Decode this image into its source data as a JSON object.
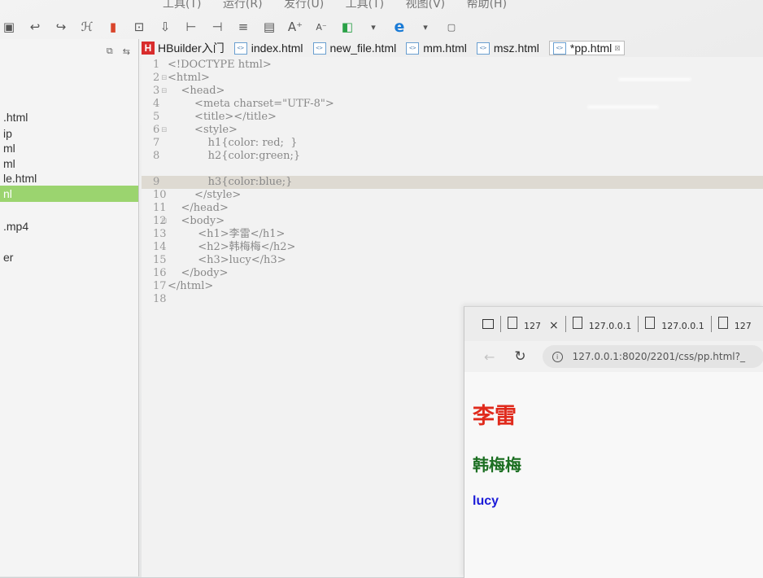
{
  "menubar": [
    "工具(T)",
    "运行(R)",
    "发行(U)",
    "工具(T)",
    "视图(V)",
    "帮助(H)"
  ],
  "toolbar_icons": [
    "save-icon",
    "undo-icon",
    "redo-icon",
    "format-icon",
    "bookmark-icon",
    "new-file-icon",
    "import-icon",
    "indent-icon",
    "outdent-icon",
    "wrap-icon",
    "comment-icon",
    "font-increase-icon",
    "font-decrease-icon",
    "run-icon",
    "browser-icon",
    "settings-icon"
  ],
  "sidebar": {
    "items": [
      ".html",
      "ip",
      "ml",
      "ml",
      "le.html",
      "nl",
      ".mp4",
      "er"
    ]
  },
  "tabs": [
    {
      "label": "HBuilder入门",
      "active": false
    },
    {
      "label": "index.html",
      "active": false
    },
    {
      "label": "new_file.html",
      "active": false
    },
    {
      "label": "mm.html",
      "active": false
    },
    {
      "label": "msz.html",
      "active": false
    },
    {
      "label": "*pp.html",
      "active": true
    }
  ],
  "editor": {
    "lines": [
      {
        "n": "1",
        "code": "<!DOCTYPE html>"
      },
      {
        "n": "2",
        "code": "<html>"
      },
      {
        "n": "3",
        "code": "    <head>"
      },
      {
        "n": "4",
        "code": "        <meta charset=\"UTF-8\">"
      },
      {
        "n": "5",
        "code": "        <title></title>"
      },
      {
        "n": "6",
        "code": "        <style>"
      },
      {
        "n": "7",
        "code": "            h1{color: red;  }"
      },
      {
        "n": "8",
        "code": "            h2{color:green;}"
      },
      {
        "n": "9",
        "code": "            h3{color:blue;}"
      },
      {
        "n": "10",
        "code": "        </style>"
      },
      {
        "n": "11",
        "code": "    </head>"
      },
      {
        "n": "12",
        "code": "    <body>"
      },
      {
        "n": "13",
        "code": "         <h1>李雷</h1>"
      },
      {
        "n": "14",
        "code": "         <h2>韩梅梅</h2>"
      },
      {
        "n": "15",
        "code": "         <h3>lucy</h3>"
      },
      {
        "n": "16",
        "code": "    </body>"
      },
      {
        "n": "17",
        "code": "</html>"
      },
      {
        "n": "18",
        "code": ""
      }
    ],
    "highlighted_line": 9
  },
  "browser": {
    "tabs": [
      "127",
      "127.0.0.1",
      "127.0.0.1",
      "127"
    ],
    "url": "127.0.0.1:8020/2201/css/pp.html?_",
    "output": {
      "h1": "李雷",
      "h2": "韩梅梅",
      "h3": "lucy"
    },
    "colors": {
      "h1": "#e02a1c",
      "h2": "#1c6f22",
      "h3": "#1a1ad8"
    }
  }
}
